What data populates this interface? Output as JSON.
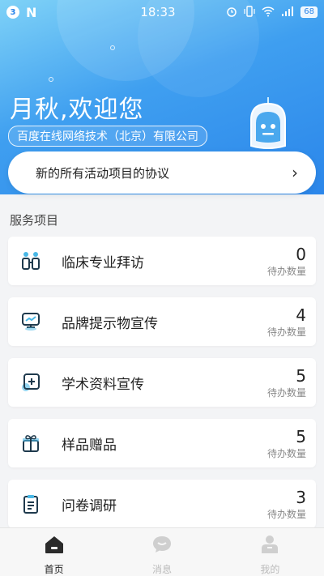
{
  "status_bar": {
    "badge": "3",
    "app_letter": "N",
    "time": "18:33",
    "battery": "68"
  },
  "header": {
    "greeting": "月秋,欢迎您",
    "company": "百度在线网络技术（北京）有限公司"
  },
  "notice": {
    "text": "新的所有活动项目的协议",
    "chevron": "›"
  },
  "services": {
    "title": "服务项目",
    "items": [
      {
        "label": "临床专业拜访",
        "count": "0",
        "sub": "待办数量",
        "icon": "people-icon"
      },
      {
        "label": "品牌提示物宣传",
        "count": "4",
        "sub": "待办数量",
        "icon": "presentation-board-icon"
      },
      {
        "label": "学术资料宣传",
        "count": "5",
        "sub": "待办数量",
        "icon": "document-add-icon"
      },
      {
        "label": "样品赠品",
        "count": "5",
        "sub": "待办数量",
        "icon": "gift-icon"
      },
      {
        "label": "问卷调研",
        "count": "3",
        "sub": "待办数量",
        "icon": "clipboard-icon"
      }
    ]
  },
  "tabbar": {
    "items": [
      {
        "label": "首页",
        "icon": "home-icon",
        "active": true
      },
      {
        "label": "消息",
        "icon": "message-icon",
        "active": false
      },
      {
        "label": "我的",
        "icon": "profile-icon",
        "active": false
      }
    ]
  },
  "colors": {
    "brand": "#2b86ea",
    "icon_dark": "#1f3a4d",
    "icon_accent": "#49b8e6"
  }
}
